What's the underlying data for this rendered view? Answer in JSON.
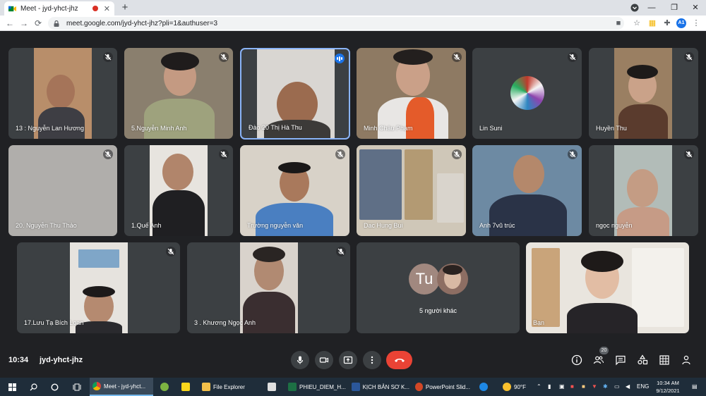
{
  "browser": {
    "tab_title": "Meet - jyd-yhct-jhz",
    "url": "meet.google.com/jyd-yhct-jhz?pli=1&authuser=3",
    "profile_initials": "A1"
  },
  "participants_row1": [
    {
      "name": "13 : Nguyễn Lan Hương"
    },
    {
      "name": "5.Nguyễn Minh Anh"
    },
    {
      "name": "Đào 20 Thị Hà Thu"
    },
    {
      "name": "Minh Châu Phạm"
    },
    {
      "name": "Lin Suni"
    },
    {
      "name": "Huyền Thu"
    }
  ],
  "participants_row2": [
    {
      "name": "20. Nguyễn Thu Thảo"
    },
    {
      "name": "1.Quế Anh"
    },
    {
      "name": "Trường nguyễn văn"
    },
    {
      "name": "Dac Hung Bui"
    },
    {
      "name": "Anh 7vũ trúc"
    },
    {
      "name": "ngọc nguyễn"
    }
  ],
  "participants_row3": [
    {
      "name": "17.Lưu Tạ Bích Loan"
    },
    {
      "name": "3 . Khương Ngọc Anh"
    },
    {
      "name": "Bạn"
    }
  ],
  "others": {
    "initials": "Tu",
    "label": "5 người khác"
  },
  "meeting": {
    "time": "10:34",
    "code": "jyd-yhct-jhz",
    "participant_count": "20"
  },
  "taskbar": {
    "apps": [
      "Meet - jyd-yhct...",
      "File Explorer",
      "PHIEU_DIEM_H...",
      "KỊCH BẢN SƠ K...",
      "PowerPoint Slid..."
    ],
    "weather": "90°F",
    "lang": "ENG",
    "time": "10:34 AM",
    "date": "9/12/2021"
  },
  "colors": {
    "end_call": "#ea4335",
    "active_border": "#8ab4f8",
    "tile_bg": "#3c4043",
    "stage_bg": "#202124"
  }
}
